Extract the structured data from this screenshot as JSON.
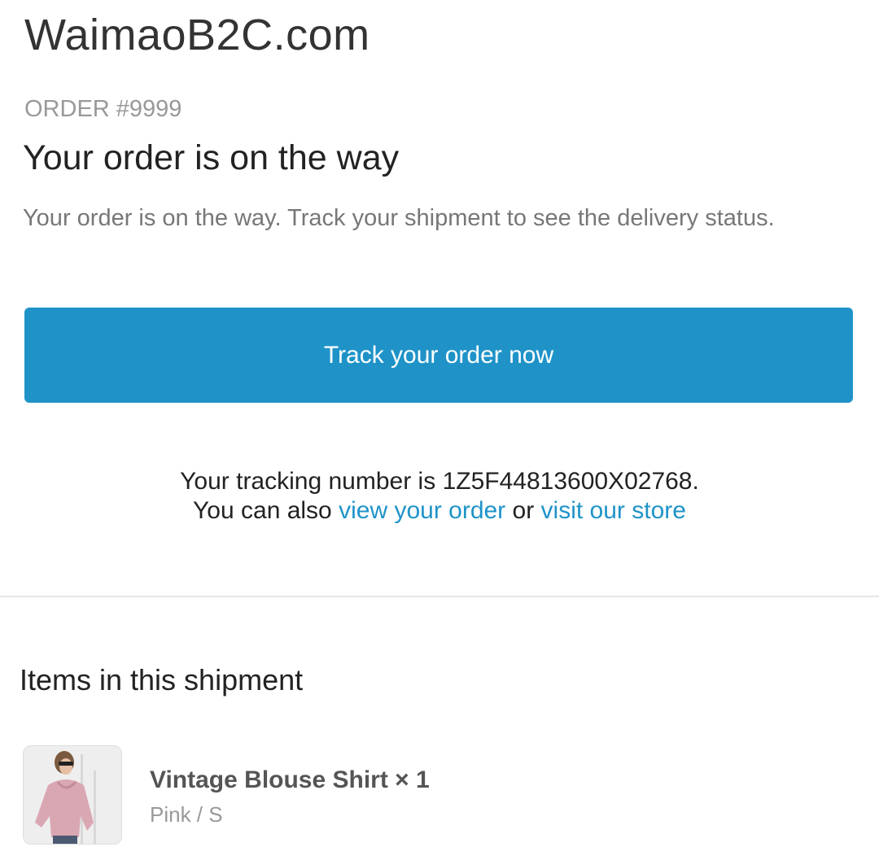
{
  "shop": {
    "name": "WaimaoB2C.com"
  },
  "order": {
    "number_label": "ORDER #9999",
    "headline": "Your order is on the way",
    "description": "Your order is on the way. Track your shipment to see the delivery status."
  },
  "actions": {
    "track_button_label": "Track your order now"
  },
  "tracking": {
    "prefix": "Your tracking number is",
    "number": "1Z5F44813600X02768",
    "suffix": ".",
    "line2_prefix": "You can also",
    "view_order_link": "view your order",
    "conjunction": "or",
    "visit_store_link": "visit our store"
  },
  "shipment": {
    "section_title": "Items in this shipment",
    "items": [
      {
        "title": "Vintage Blouse Shirt × 1",
        "variant": "Pink / S"
      }
    ]
  },
  "colors": {
    "accent": "#1f93c8",
    "text_primary": "#222222",
    "text_muted": "#777777"
  }
}
